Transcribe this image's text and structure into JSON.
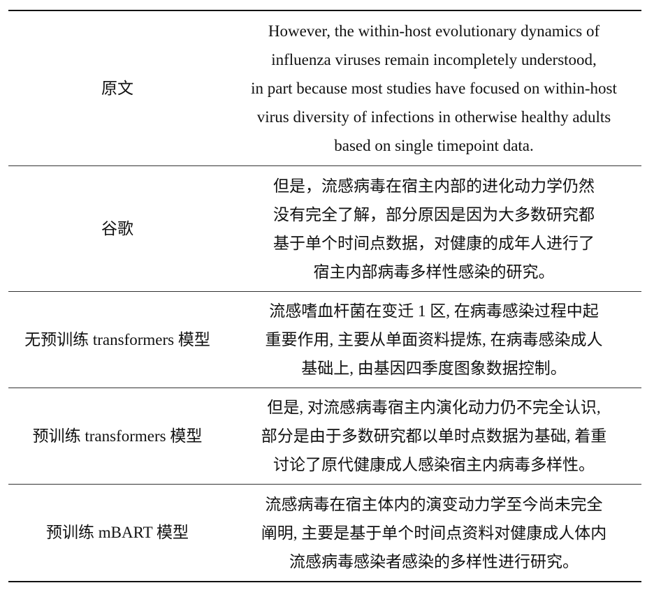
{
  "rows": [
    {
      "label": "原文",
      "lines": [
        "However, the within-host evolutionary dynamics of",
        "influenza viruses remain incompletely understood,",
        "in part because most studies have focused on within-host",
        "virus diversity of infections in otherwise healthy adults",
        "based on single timepoint data."
      ]
    },
    {
      "label": "谷歌",
      "lines": [
        "但是，流感病毒在宿主内部的进化动力学仍然",
        "没有完全了解，部分原因是因为大多数研究都",
        "基于单个时间点数据，对健康的成年人进行了",
        "宿主内部病毒多样性感染的研究。"
      ]
    },
    {
      "label": "无预训练 transformers 模型",
      "lines": [
        "流感嗜血杆菌在变迁 1 区, 在病毒感染过程中起",
        "重要作用, 主要从单面资料提炼, 在病毒感染成人",
        "基础上, 由基因四季度图象数据控制。"
      ]
    },
    {
      "label": "预训练 transformers 模型",
      "lines": [
        "但是, 对流感病毒宿主内演化动力仍不完全认识,",
        "部分是由于多数研究都以单时点数据为基础, 着重",
        "讨论了原代健康成人感染宿主内病毒多样性。"
      ]
    },
    {
      "label": "预训练 mBART 模型",
      "lines": [
        "流感病毒在宿主体内的演变动力学至今尚未完全",
        "阐明, 主要是基于单个时间点资料对健康成人体内",
        "流感病毒感染者感染的多样性进行研究。"
      ]
    }
  ]
}
